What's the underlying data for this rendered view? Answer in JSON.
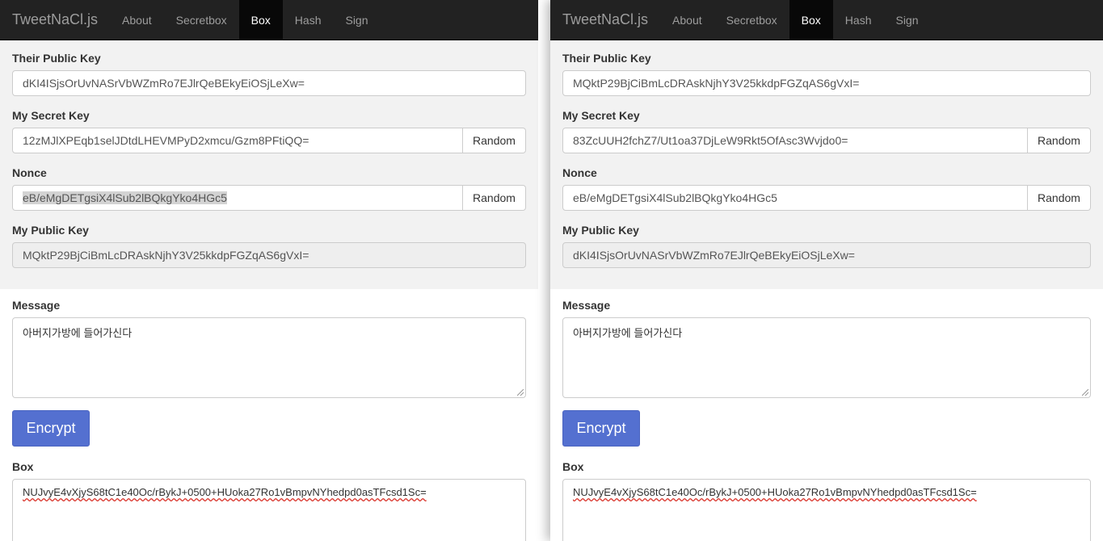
{
  "nav": {
    "brand": "TweetNaCl.js",
    "items": [
      "About",
      "Secretbox",
      "Box",
      "Hash",
      "Sign"
    ],
    "active": "Box"
  },
  "labels": {
    "their_public_key": "Their Public Key",
    "my_secret_key": "My Secret Key",
    "nonce": "Nonce",
    "my_public_key": "My Public Key",
    "message": "Message",
    "box": "Box",
    "random": "Random",
    "encrypt": "Encrypt"
  },
  "left": {
    "their_public_key": "dKI4ISjsOrUvNASrVbWZmRo7EJlrQeBEkyEiOSjLeXw=",
    "my_secret_key": "12zMJlXPEqb1selJDtdLHEVMPyD2xmcu/Gzm8PFtiQQ=",
    "nonce": "eB/eMgDETgsiX4lSub2lBQkgYko4HGc5",
    "my_public_key": "MQktP29BjCiBmLcDRAskNjhY3V25kkdpFGZqAS6gVxI=",
    "message": "아버지가방에 들어가신다",
    "box": "NUJvyE4vXjyS68tC1e40Oc/rBykJ+0500+HUoka27Ro1vBmpvNYhedpd0asTFcsd1Sc="
  },
  "right": {
    "their_public_key": "MQktP29BjCiBmLcDRAskNjhY3V25kkdpFGZqAS6gVxI=",
    "my_secret_key": "83ZcUUH2fchZ7/Ut1oa37DjLeW9Rkt5OfAsc3Wvjdo0=",
    "nonce": "eB/eMgDETgsiX4lSub2lBQkgYko4HGc5",
    "my_public_key": "dKI4ISjsOrUvNASrVbWZmRo7EJlrQeBEkyEiOSjLeXw=",
    "message": "아버지가방에 들어가신다",
    "box": "NUJvyE4vXjyS68tC1e40Oc/rBykJ+0500+HUoka27Ro1vBmpvNYhedpd0asTFcsd1Sc="
  }
}
